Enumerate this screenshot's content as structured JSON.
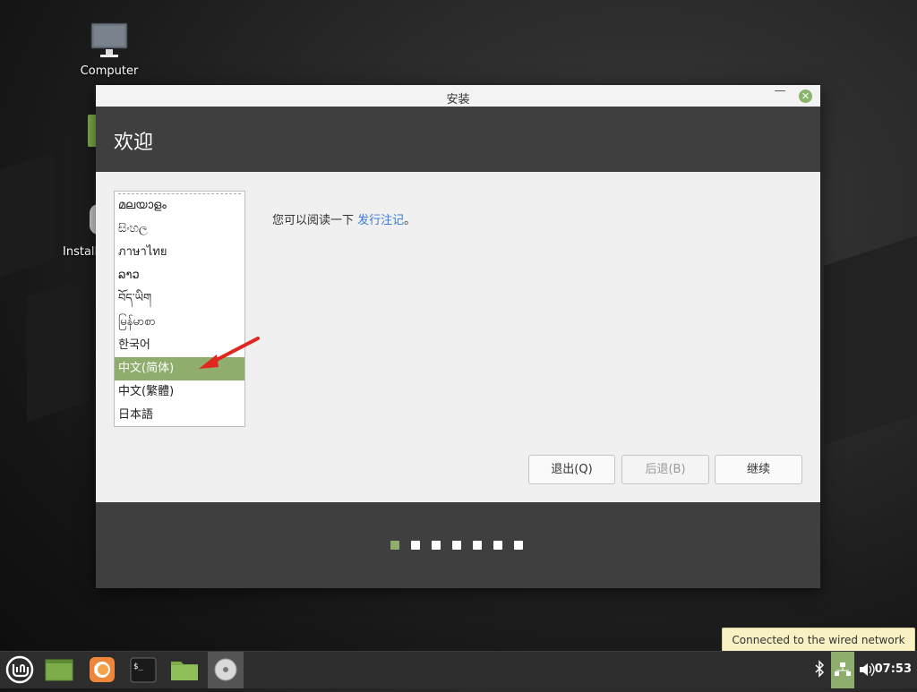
{
  "desktop": {
    "computer_label": "Computer",
    "install_label": "Install"
  },
  "window": {
    "title": "安装",
    "header_title": "欢迎",
    "languages": [
      {
        "label": "മലയാളം",
        "selected": false
      },
      {
        "label": "සිංහල",
        "selected": false
      },
      {
        "label": "ภาษาไทย",
        "selected": false
      },
      {
        "label": "ລາວ",
        "selected": false
      },
      {
        "label": "བོད་ཡིག",
        "selected": false
      },
      {
        "label": "မြန်မာစာ",
        "selected": false
      },
      {
        "label": "한국어",
        "selected": false
      },
      {
        "label": "中文(简体)",
        "selected": true
      },
      {
        "label": "中文(繁體)",
        "selected": false
      },
      {
        "label": "日本語",
        "selected": false
      }
    ],
    "release_text": "您可以阅读一下 ",
    "release_link": "发行注记",
    "release_suffix": "。",
    "buttons": {
      "quit": "退出(Q)",
      "back": "后退(B)",
      "continue": "继续"
    },
    "progress": {
      "total_steps": 7,
      "current_step": 1
    }
  },
  "tooltip": "Connected to the wired network",
  "taskbar": {
    "clock": "07:53"
  },
  "colors": {
    "accent": "#8fad6c",
    "link": "#3a7bd5",
    "header": "#3f3f3f"
  }
}
